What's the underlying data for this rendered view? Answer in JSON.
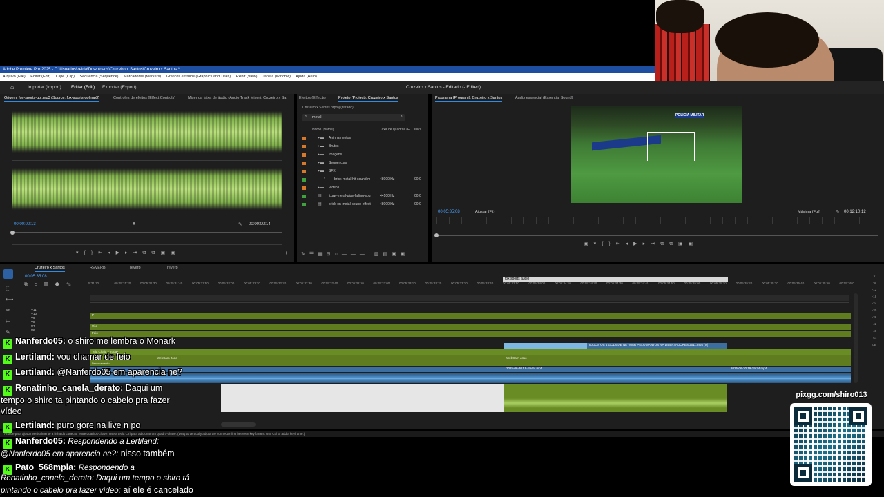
{
  "premiere": {
    "title": "Adobe Premiere Pro 2025 - C:\\Usuarios\\zelda\\Downloads\\Cruzeiro x Santos\\Cruzeiro x Santos *",
    "menu": [
      "Arquivo (File)",
      "Editar (Edit)",
      "Clipe (Clip)",
      "Sequência (Sequence)",
      "Marcadores (Markers)",
      "Gráficos e títulos (Graphics and Titles)",
      "Exibir (View)",
      "Janela (Window)",
      "Ajuda (Help)"
    ],
    "header": {
      "import": "Importar (Import)",
      "edit": "Editar (Edit)",
      "export": "Exportar (Export)",
      "project_title": "Cruzeiro x Santos - Editado (- Edited)"
    },
    "source": {
      "tabs": [
        "Origem: fox-sports-gol.mp3 (Source: fox-sports-gol.mp3)",
        "Controles de efeitos (Effect Controls)",
        "Mixer da faixa de áudio (Audio Track Mixer): Cruzeiro x Sa"
      ],
      "timecode_in": "00:00:00:13",
      "timecode_dur": "00:00:00:14"
    },
    "project": {
      "tabs": [
        "Efeitos (Effects)",
        "Projeto (Project): Cruzeiro x Santos"
      ],
      "file": "Cruzeiro x Santos.prproj (filtrado)",
      "search": "metal",
      "col_name": "Nome (Name)",
      "col_rate": "Taxa de quadros (F",
      "col_start": "Inici",
      "items": [
        {
          "name": "Aninhamentos",
          "rate": "",
          "start": "",
          "color": "#d7792a",
          "indent": 1,
          "type": "folder"
        },
        {
          "name": "Brutos",
          "rate": "",
          "start": "",
          "color": "#d7792a",
          "indent": 1,
          "type": "folder"
        },
        {
          "name": "Imagens",
          "rate": "",
          "start": "",
          "color": "#d7792a",
          "indent": 1,
          "type": "folder"
        },
        {
          "name": "Sequencias",
          "rate": "",
          "start": "",
          "color": "#d7792a",
          "indent": 1,
          "type": "folder"
        },
        {
          "name": "SFX",
          "rate": "",
          "start": "",
          "color": "#d7792a",
          "indent": 1,
          "type": "folder"
        },
        {
          "name": "brick-metal-hit-sound.m",
          "rate": "48000 Hz",
          "start": "00:0",
          "color": "#3fa23f",
          "indent": 2,
          "type": "audio"
        },
        {
          "name": "Videos",
          "rate": "",
          "start": "",
          "color": "#d7792a",
          "indent": 1,
          "type": "folder"
        },
        {
          "name": "jixaw-metal-pipe-falling-sou",
          "rate": "44100 Hz",
          "start": "00:0",
          "color": "#3fa23f",
          "indent": 1,
          "type": "seq"
        },
        {
          "name": "brick-on-metal-sound-effect",
          "rate": "48000 Hz",
          "start": "00:0",
          "color": "#3fa23f",
          "indent": 1,
          "type": "seq"
        }
      ]
    },
    "program": {
      "tabs": [
        "Programa (Program): Cruzeiro x Santos",
        "Áudio essencial (Essential Sound)"
      ],
      "timecode": "00:05:35:08",
      "fit": "Ajustar (Fit)",
      "quality": "Máxima (Full)",
      "duration": "00:12:10:12",
      "video_text": "POLÍCIA MILITAR"
    },
    "timeline": {
      "tabs": [
        "Cruzeiro x Santos",
        "REVERB",
        "reverb",
        "reverb"
      ],
      "timecode": "00:05:35:08",
      "ruler": [
        "5:31:10",
        "00:05:31:20",
        "00:05:31:30",
        "00:05:31:40",
        "00:05:31:50",
        "00:05:32:00",
        "00:05:32:10",
        "00:05:32:20",
        "00:05:32:30",
        "00:05:32:40",
        "00:05:32:50",
        "00:05:33:00",
        "00:05:33:10",
        "00:05:33:20",
        "00:05:33:30",
        "00:05:33:40",
        "00:05:33:50",
        "00:05:34:00",
        "00:05:34:10",
        "00:05:34:20",
        "00:05:34:30",
        "00:05:34:40",
        "00:05:34:50",
        "00:05:35:00",
        "00:05:35:10",
        "00:05:35:20",
        "00:05:35:30",
        "00:05:35:40",
        "00:05:35:50",
        "00:05:36:0"
      ],
      "tracks": [
        "V11",
        "V10",
        "V9",
        "V8",
        "V7",
        "V6"
      ],
      "clip_label": "fox sports audio",
      "clip_blue": "TODOS OS 4 GOLS DE NEYMAR PELO SANTOS NA LIBERTADORES 2011.mp4 [V]",
      "clip_webcam_left": "WebCam Joao",
      "clip_webcam_right": "WebCam Joao",
      "clip_audio1": "2025-06-30 19-19-34.mp4",
      "clip_audio2": "2025-06-30 19-19-34.mp4",
      "track_labels": [
        "P",
        "Vàs",
        "Feio",
        "Tela Chaia + Todas",
        "Deslocamento"
      ],
      "status": "Arraste para ajustar verticalmente a linha do conector entre quadros-chave. Use a tecla Ctrl para adicionar um quadro-chave. (Drag to vertically adjust the connector line between keyframes. Use Ctrl to add a keyframe.)"
    }
  },
  "chat": [
    {
      "user": "Nanferdo05:",
      "msg": "o shiro me lembra o Monark"
    },
    {
      "user": "Lertiland:",
      "msg": "vou chamar de feio"
    },
    {
      "user": "Lertiland:",
      "msg": "@Nanferdo05 em aparencia ne?"
    },
    {
      "user": "Renatinho_canela_derato:",
      "msg": "Daqui um",
      "cont1": "tempo o shiro ta pintando o cabelo pra fazer",
      "cont2": "vídeo"
    },
    {
      "user": "Lertiland:",
      "msg": "puro gore na live n po"
    },
    {
      "user": "Nanferdo05:",
      "reply": "Respondendo a Lertiland:",
      "cont1a": "@Nanferdo05 em aparencia ne?:",
      "cont1b": "nisso também"
    },
    {
      "user": "Pato_568mpla:",
      "reply": "Respondendo a",
      "cont1a": "Renatinho_canela_derato: Daqui um tempo o shiro tá",
      "cont2a": "pintando o cabelo pra fazer vídeo:",
      "cont2b": "aí ele é cancelado"
    }
  ],
  "qr": {
    "label": "pixgg.com/shiro013"
  },
  "colors": {
    "accent": "#2d8ceb",
    "kick": "#53fc18",
    "title_bar": "#1d4ea0",
    "waveform": "#b8e07a"
  }
}
